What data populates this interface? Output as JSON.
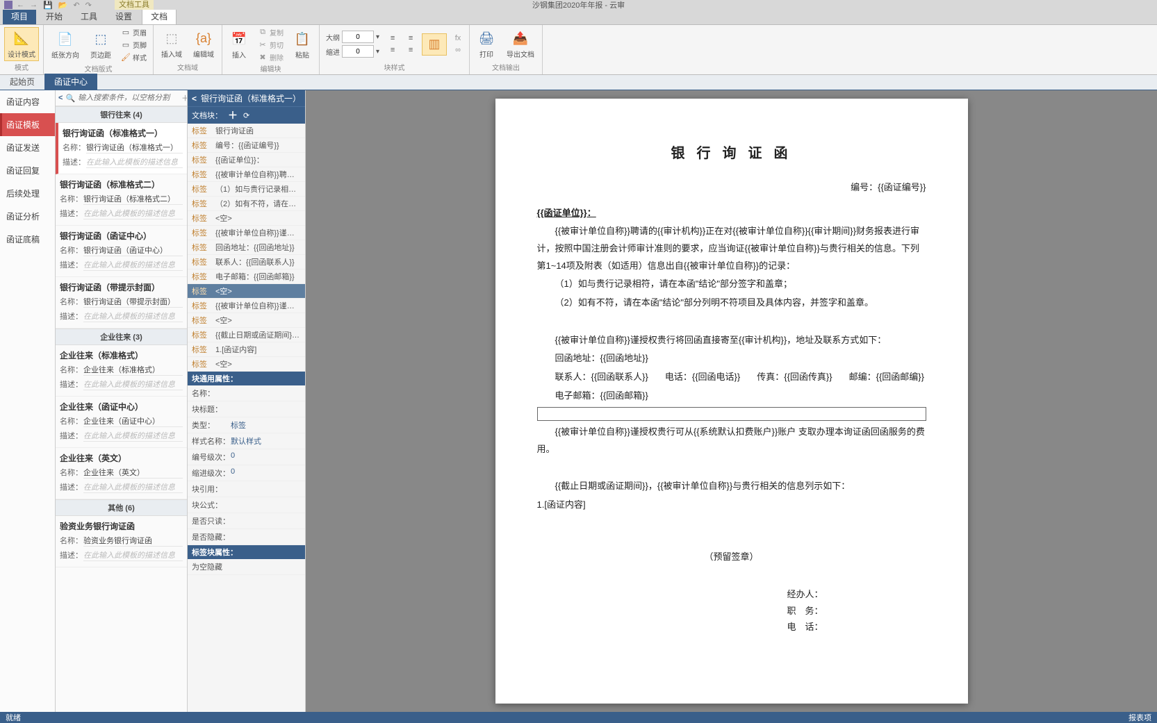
{
  "app": {
    "title": "沙钢集团2020年年报 - 云审",
    "tool_tab": "文档工具",
    "qat": {
      "back": "←",
      "fwd": "→",
      "save": "💾",
      "open": "📂",
      "undo": "↶",
      "redo": "↷"
    }
  },
  "menu": {
    "tabs": [
      "项目",
      "开始",
      "工具",
      "设置",
      "文档"
    ],
    "active": "文档",
    "primary": "项目"
  },
  "ribbon": {
    "groups": {
      "mode": {
        "label": "模式",
        "design": "设计模式"
      },
      "pagefmt": {
        "label": "文档版式",
        "orient": "纸张方向",
        "margin": "页边距",
        "header": "页眉",
        "footer": "页脚",
        "style": "样式"
      },
      "docfield": {
        "label": "文档域",
        "insertf": "插入域",
        "editf": "编辑域"
      },
      "editblk": {
        "label": "编辑块",
        "insert": "插入",
        "copy": "复制",
        "cut": "剪切",
        "del": "删除",
        "paste": "粘贴"
      },
      "blkstyle": {
        "label": "块样式",
        "outline": "大纲",
        "outline_val": "0",
        "indent": "缩进",
        "indent_val": "0",
        "fx": "fx",
        "link": "∞"
      },
      "docout": {
        "label": "文档输出",
        "print": "打印",
        "export": "导出文档"
      }
    }
  },
  "pagetabs": {
    "start": "起始页",
    "center": "函证中心",
    "active": "center"
  },
  "leftnav": {
    "items": [
      "函证内容",
      "函证模板",
      "函证发送",
      "函证回复",
      "后续处理",
      "函证分析",
      "函证底稿"
    ],
    "active": 1
  },
  "tpl": {
    "search_ph": "输入搜索条件，以空格分割",
    "cats": [
      {
        "title": "银行往来  (4)",
        "items": [
          {
            "title": "银行询证函（标准格式一）",
            "name": "银行询证函（标准格式一）",
            "sel": true
          },
          {
            "title": "银行询证函（标准格式二）",
            "name": "银行询证函（标准格式二）"
          },
          {
            "title": "银行询证函（函证中心）",
            "name": "银行询证函（函证中心）"
          },
          {
            "title": "银行询证函（带提示封面）",
            "name": "银行询证函（带提示封面）"
          }
        ]
      },
      {
        "title": "企业往来  (3)",
        "items": [
          {
            "title": "企业往来（标准格式）",
            "name": "企业往来（标准格式）"
          },
          {
            "title": "企业往来（函证中心）",
            "name": "企业往来（函证中心）"
          },
          {
            "title": "企业往来（英文）",
            "name": "企业往来（英文）"
          }
        ]
      },
      {
        "title": "其他  (6)",
        "items": [
          {
            "title": "验资业务银行询证函",
            "name": "验资业务银行询证函"
          }
        ]
      }
    ],
    "name_label": "名称：",
    "desc_label": "描述：",
    "desc_ph": "在此输入此模板的描述信息"
  },
  "blk": {
    "title": "银行询证函（标准格式一）",
    "toolbar": "文档块：",
    "items": [
      {
        "tag": "标签",
        "txt": "银行询证函"
      },
      {
        "tag": "标签",
        "txt": "编号：{{函证编号}}"
      },
      {
        "tag": "标签",
        "txt": "{{函证单位}}："
      },
      {
        "tag": "标签",
        "txt": "{{被审计单位自称}}聘请…"
      },
      {
        "tag": "标签",
        "txt": "（1）如与贵行记录相…"
      },
      {
        "tag": "标签",
        "txt": "（2）如有不符，请在…"
      },
      {
        "tag": "标签",
        "txt": "<空>"
      },
      {
        "tag": "标签",
        "txt": "{{被审计单位自称}}谨授…"
      },
      {
        "tag": "标签",
        "txt": "回函地址：{{回函地址}}"
      },
      {
        "tag": "标签",
        "txt": "联系人：{{回函联系人}}"
      },
      {
        "tag": "标签",
        "txt": "电子邮箱：{{回函邮箱}}"
      },
      {
        "tag": "标签",
        "txt": "<空>",
        "sel": true
      },
      {
        "tag": "标签",
        "txt": "{{被审计单位自称}}谨授…"
      },
      {
        "tag": "标签",
        "txt": "<空>"
      },
      {
        "tag": "标签",
        "txt": "{{截止日期或函证期间}}…"
      },
      {
        "tag": "标签",
        "txt": "1.[函证内容]"
      },
      {
        "tag": "标签",
        "txt": "<空>"
      }
    ],
    "sec_common": "块通用属性：",
    "props_common": [
      {
        "k": "名称：",
        "v": ""
      },
      {
        "k": "块标题：",
        "v": ""
      },
      {
        "k": "类型：",
        "v": "标签"
      },
      {
        "k": "样式名称：",
        "v": "默认样式"
      },
      {
        "k": "编号级次：",
        "v": "0"
      },
      {
        "k": "缩进级次：",
        "v": "0"
      },
      {
        "k": "块引用：",
        "v": ""
      },
      {
        "k": "块公式：",
        "v": ""
      },
      {
        "k": "是否只读：",
        "v": ""
      },
      {
        "k": "是否隐藏：",
        "v": ""
      }
    ],
    "sec_tag": "标签块属性：",
    "props_tag": [
      {
        "k": "为空隐藏",
        "v": ""
      }
    ]
  },
  "doc": {
    "title": "银 行 询 证 函",
    "serial": "编号：{{函证编号}}",
    "unit": "{{函证单位}}：",
    "para1": "{{被审计单位自称}}聘请的{{审计机构}}正在对{{被审计单位自称}}{{审计期间}}财务报表进行审计，按照中国注册会计师审计准则的要求，应当询证{{被审计单位自称}}与贵行相关的信息。下列第1~14项及附表（如适用）信息出自{{被审计单位自称}}的记录：",
    "li1": "（1）如与贵行记录相符，请在本函\"结论\"部分签字和盖章；",
    "li2": "（2）如有不符，请在本函\"结论\"部分列明不符项目及具体内容，并签字和盖章。",
    "para2": "{{被审计单位自称}}谨授权贵行将回函直接寄至{{审计机构}}，地址及联系方式如下：",
    "addr": "回函地址：{{回函地址}}",
    "contacts": {
      "contact": "联系人：{{回函联系人}}",
      "phone": "电话：{{回函电话}}",
      "fax": "传真：{{回函传真}}",
      "zip": "邮编：{{回函邮编}}"
    },
    "email": "电子邮箱：{{回函邮箱}}",
    "para3": "{{被审计单位自称}}谨授权贵行可从{{系统默认扣费账户}}账户 支取办理本询证函回函服务的费用。",
    "para4": "{{截止日期或函证期间}}，{{被审计单位自称}}与贵行相关的信息列示如下：",
    "item1": "1.[函证内容]",
    "seal": "（预留签章）",
    "sig_handler": "经办人：",
    "sig_title": "职　务：",
    "sig_phone": "电　话："
  },
  "status": {
    "left": "就绪",
    "right": "报表项"
  }
}
